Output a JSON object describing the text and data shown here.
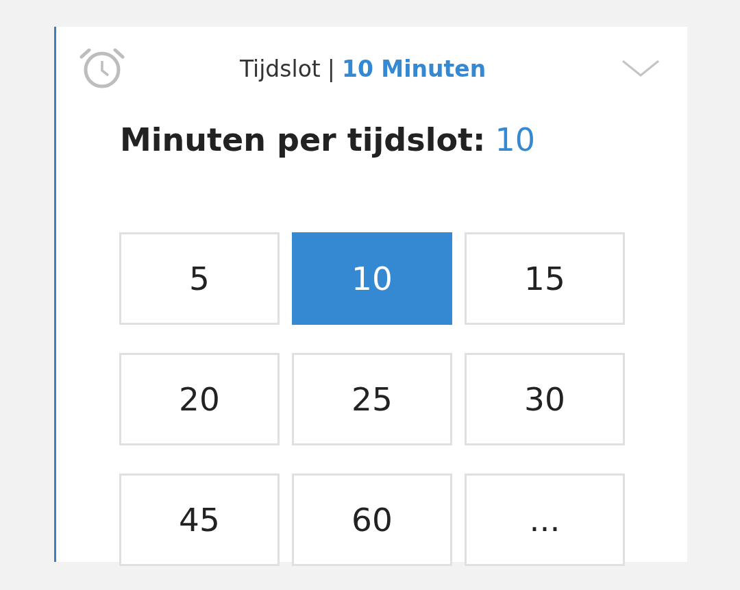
{
  "header": {
    "label": "Tijdslot",
    "separator": "|",
    "value": "10 Minuten",
    "expanded": true
  },
  "heading": {
    "label": "Minuten per tijdslot:",
    "value": "10"
  },
  "options": [
    {
      "label": "5",
      "selected": false
    },
    {
      "label": "10",
      "selected": true
    },
    {
      "label": "15",
      "selected": false
    },
    {
      "label": "20",
      "selected": false
    },
    {
      "label": "25",
      "selected": false
    },
    {
      "label": "30",
      "selected": false
    },
    {
      "label": "45",
      "selected": false
    },
    {
      "label": "60",
      "selected": false
    },
    {
      "label": "...",
      "selected": false
    }
  ]
}
